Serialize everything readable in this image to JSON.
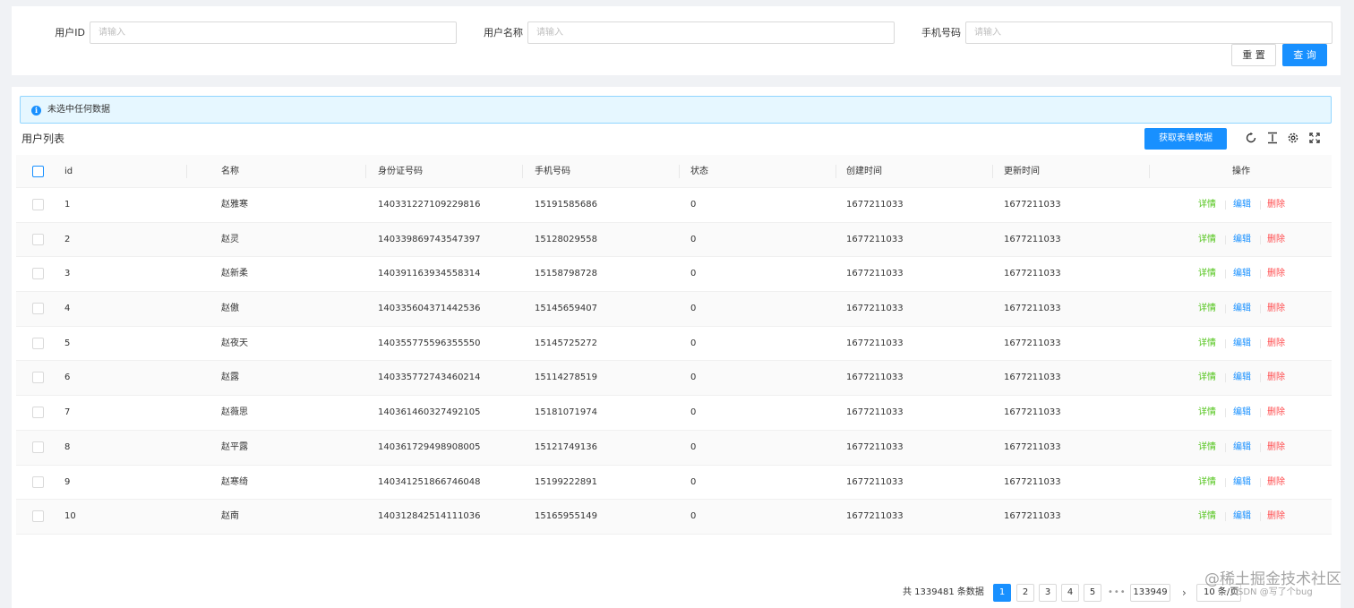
{
  "search": {
    "fields": [
      {
        "label": "用户ID",
        "placeholder": "请输入",
        "value": ""
      },
      {
        "label": "用户名称",
        "placeholder": "请输入",
        "value": ""
      },
      {
        "label": "手机号码",
        "placeholder": "请输入",
        "value": ""
      }
    ],
    "reset_label": "重 置",
    "query_label": "查 询"
  },
  "alert": {
    "text": "未选中任何数据",
    "icon": "info-icon",
    "icon_glyph": "i"
  },
  "table": {
    "title": "用户列表",
    "fetch_button": "获取表单数据",
    "tools": [
      "reload-icon",
      "column-height-icon",
      "setting-icon",
      "fullscreen-icon"
    ],
    "columns": [
      "id",
      "名称",
      "身份证号码",
      "手机号码",
      "状态",
      "创建时间",
      "更新时间",
      "操作"
    ],
    "rows": [
      {
        "id": "1",
        "name": "赵雅寒",
        "idcard": "140331227109229816",
        "phone": "15191585686",
        "status": "0",
        "created": "1677211033",
        "updated": "1677211033"
      },
      {
        "id": "2",
        "name": "赵灵",
        "idcard": "140339869743547397",
        "phone": "15128029558",
        "status": "0",
        "created": "1677211033",
        "updated": "1677211033"
      },
      {
        "id": "3",
        "name": "赵新柔",
        "idcard": "140391163934558314",
        "phone": "15158798728",
        "status": "0",
        "created": "1677211033",
        "updated": "1677211033"
      },
      {
        "id": "4",
        "name": "赵傲",
        "idcard": "140335604371442536",
        "phone": "15145659407",
        "status": "0",
        "created": "1677211033",
        "updated": "1677211033"
      },
      {
        "id": "5",
        "name": "赵夜天",
        "idcard": "140355775596355550",
        "phone": "15145725272",
        "status": "0",
        "created": "1677211033",
        "updated": "1677211033"
      },
      {
        "id": "6",
        "name": "赵露",
        "idcard": "140335772743460214",
        "phone": "15114278519",
        "status": "0",
        "created": "1677211033",
        "updated": "1677211033"
      },
      {
        "id": "7",
        "name": "赵薇思",
        "idcard": "140361460327492105",
        "phone": "15181071974",
        "status": "0",
        "created": "1677211033",
        "updated": "1677211033"
      },
      {
        "id": "8",
        "name": "赵平露",
        "idcard": "140361729498908005",
        "phone": "15121749136",
        "status": "0",
        "created": "1677211033",
        "updated": "1677211033"
      },
      {
        "id": "9",
        "name": "赵寒绮",
        "idcard": "140341251866746048",
        "phone": "15199222891",
        "status": "0",
        "created": "1677211033",
        "updated": "1677211033"
      },
      {
        "id": "10",
        "name": "赵南",
        "idcard": "140312842514111036",
        "phone": "15165955149",
        "status": "0",
        "created": "1677211033",
        "updated": "1677211033"
      }
    ],
    "actions": {
      "detail": "详情",
      "edit": "编辑",
      "delete": "删除"
    }
  },
  "pagination": {
    "total_text": "共 1339481 条数据",
    "pages": [
      "1",
      "2",
      "3",
      "4",
      "5"
    ],
    "current": "1",
    "ellipsis": "•••",
    "last_page": "133949",
    "next": "›",
    "page_size": "10 条/页"
  },
  "watermark": {
    "line1": "@稀土掘金技术社区",
    "line2": "CSDN @写了个bug"
  },
  "colors": {
    "primary": "#1890ff",
    "success": "#52c41a",
    "danger": "#ff4d4f",
    "alert_bg": "#e6f7ff"
  }
}
